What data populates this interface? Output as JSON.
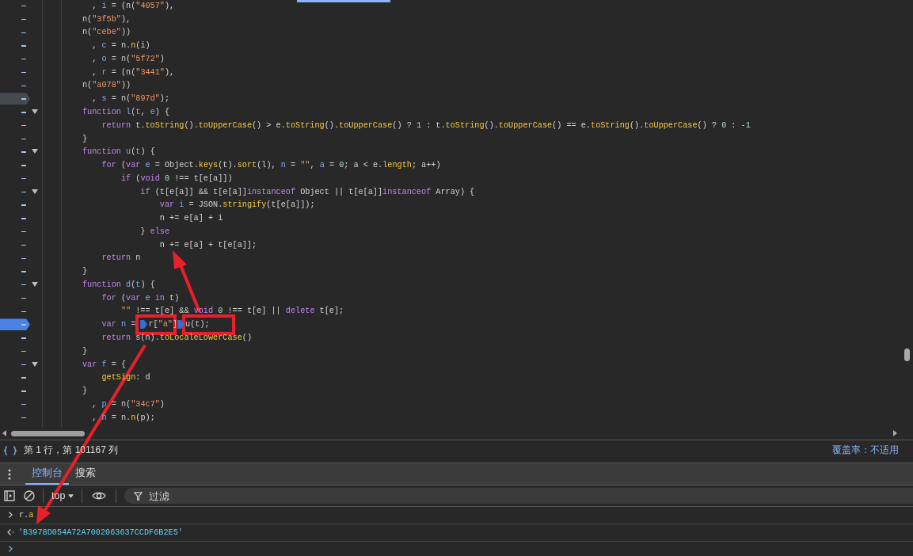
{
  "editor": {
    "lines": [
      {
        "foldable": false,
        "tokens": [
          {
            "text": "  , ",
            "kind": "plain"
          },
          {
            "text": "i",
            "kind": "variable"
          },
          {
            "text": " = (n(",
            "kind": "plain"
          },
          {
            "text": "\"4057\"",
            "kind": "string"
          },
          {
            "text": "),",
            "kind": "plain"
          }
        ]
      },
      {
        "foldable": false,
        "tokens": [
          {
            "text": "n(",
            "kind": "plain"
          },
          {
            "text": "\"3f5b\"",
            "kind": "string"
          },
          {
            "text": "),",
            "kind": "plain"
          }
        ]
      },
      {
        "foldable": false,
        "tokens": [
          {
            "text": "n(",
            "kind": "plain"
          },
          {
            "text": "\"cebe\"",
            "kind": "string"
          },
          {
            "text": "))",
            "kind": "plain"
          }
        ]
      },
      {
        "foldable": false,
        "tokens": [
          {
            "text": "  , ",
            "kind": "plain"
          },
          {
            "text": "c",
            "kind": "variable"
          },
          {
            "text": " = n.",
            "kind": "plain"
          },
          {
            "text": "n",
            "kind": "function"
          },
          {
            "text": "(i)",
            "kind": "plain"
          }
        ]
      },
      {
        "foldable": false,
        "tokens": [
          {
            "text": "  , ",
            "kind": "plain"
          },
          {
            "text": "o",
            "kind": "variable"
          },
          {
            "text": " = n(",
            "kind": "plain"
          },
          {
            "text": "\"5f72\"",
            "kind": "string"
          },
          {
            "text": ")",
            "kind": "plain"
          }
        ]
      },
      {
        "foldable": false,
        "tokens": [
          {
            "text": "  , ",
            "kind": "plain"
          },
          {
            "text": "r",
            "kind": "variable"
          },
          {
            "text": " = (n(",
            "kind": "plain"
          },
          {
            "text": "\"3441\"",
            "kind": "string"
          },
          {
            "text": "),",
            "kind": "plain"
          }
        ]
      },
      {
        "foldable": false,
        "tokens": [
          {
            "text": "n(",
            "kind": "plain"
          },
          {
            "text": "\"a078\"",
            "kind": "string"
          },
          {
            "text": "))",
            "kind": "plain"
          }
        ]
      },
      {
        "foldable": false,
        "breakpoint": {
          "enabled": false
        },
        "tokens": [
          {
            "text": "  , ",
            "kind": "plain"
          },
          {
            "text": "s",
            "kind": "variable"
          },
          {
            "text": " = n(",
            "kind": "plain"
          },
          {
            "text": "\"897d\"",
            "kind": "string"
          },
          {
            "text": ");",
            "kind": "plain"
          }
        ]
      },
      {
        "foldable": true,
        "tokens": [
          {
            "text": "function ",
            "kind": "keyword"
          },
          {
            "text": "l",
            "kind": "variable"
          },
          {
            "text": "(",
            "kind": "plain"
          },
          {
            "text": "t",
            "kind": "variable"
          },
          {
            "text": ", ",
            "kind": "plain"
          },
          {
            "text": "e",
            "kind": "variable"
          },
          {
            "text": ") {",
            "kind": "plain"
          }
        ]
      },
      {
        "foldable": false,
        "tokens": [
          {
            "text": "    return",
            "kind": "keyword"
          },
          {
            "text": " t.",
            "kind": "plain"
          },
          {
            "text": "toString",
            "kind": "function"
          },
          {
            "text": "().",
            "kind": "plain"
          },
          {
            "text": "toUpperCase",
            "kind": "function"
          },
          {
            "text": "() > e.",
            "kind": "plain"
          },
          {
            "text": "toString",
            "kind": "function"
          },
          {
            "text": "().",
            "kind": "plain"
          },
          {
            "text": "toUpperCase",
            "kind": "function"
          },
          {
            "text": "() ? ",
            "kind": "plain"
          },
          {
            "text": "1",
            "kind": "number"
          },
          {
            "text": " : t.",
            "kind": "plain"
          },
          {
            "text": "toString",
            "kind": "function"
          },
          {
            "text": "().",
            "kind": "plain"
          },
          {
            "text": "toUpperCase",
            "kind": "function"
          },
          {
            "text": "() == e.",
            "kind": "plain"
          },
          {
            "text": "toString",
            "kind": "function"
          },
          {
            "text": "().",
            "kind": "plain"
          },
          {
            "text": "toUpperCase",
            "kind": "function"
          },
          {
            "text": "() ? ",
            "kind": "plain"
          },
          {
            "text": "0",
            "kind": "number"
          },
          {
            "text": " : ",
            "kind": "plain"
          },
          {
            "text": "-1",
            "kind": "number"
          }
        ]
      },
      {
        "foldable": false,
        "tokens": [
          {
            "text": "}",
            "kind": "plain"
          }
        ]
      },
      {
        "foldable": true,
        "tokens": [
          {
            "text": "function ",
            "kind": "keyword"
          },
          {
            "text": "u",
            "kind": "variable"
          },
          {
            "text": "(",
            "kind": "plain"
          },
          {
            "text": "t",
            "kind": "variable"
          },
          {
            "text": ") {",
            "kind": "plain"
          }
        ]
      },
      {
        "foldable": false,
        "tokens": [
          {
            "text": "    for",
            "kind": "keyword"
          },
          {
            "text": " (",
            "kind": "plain"
          },
          {
            "text": "var ",
            "kind": "keyword"
          },
          {
            "text": "e",
            "kind": "variable"
          },
          {
            "text": " = Object.",
            "kind": "plain"
          },
          {
            "text": "keys",
            "kind": "function"
          },
          {
            "text": "(t).",
            "kind": "plain"
          },
          {
            "text": "sort",
            "kind": "function"
          },
          {
            "text": "(l), ",
            "kind": "plain"
          },
          {
            "text": "n",
            "kind": "variable"
          },
          {
            "text": " = ",
            "kind": "plain"
          },
          {
            "text": "\"\"",
            "kind": "string"
          },
          {
            "text": ", ",
            "kind": "plain"
          },
          {
            "text": "a",
            "kind": "variable"
          },
          {
            "text": " = ",
            "kind": "plain"
          },
          {
            "text": "0",
            "kind": "number"
          },
          {
            "text": "; a < e.",
            "kind": "plain"
          },
          {
            "text": "length",
            "kind": "function"
          },
          {
            "text": "; a++)",
            "kind": "plain"
          }
        ]
      },
      {
        "foldable": false,
        "tokens": [
          {
            "text": "        if",
            "kind": "keyword"
          },
          {
            "text": " (",
            "kind": "plain"
          },
          {
            "text": "void ",
            "kind": "keyword"
          },
          {
            "text": "0",
            "kind": "number"
          },
          {
            "text": " !== t[e[a]])",
            "kind": "plain"
          }
        ]
      },
      {
        "foldable": true,
        "tokens": [
          {
            "text": "            if",
            "kind": "keyword"
          },
          {
            "text": " (t[e[a]] && t[e[a]]",
            "kind": "plain"
          },
          {
            "text": "instanceof",
            "kind": "keyword"
          },
          {
            "text": " Object || t[e[a]]",
            "kind": "plain"
          },
          {
            "text": "instanceof",
            "kind": "keyword"
          },
          {
            "text": " Array) {",
            "kind": "plain"
          }
        ]
      },
      {
        "foldable": false,
        "tokens": [
          {
            "text": "                var ",
            "kind": "keyword"
          },
          {
            "text": "i",
            "kind": "variable"
          },
          {
            "text": " = JSON.",
            "kind": "plain"
          },
          {
            "text": "stringify",
            "kind": "function"
          },
          {
            "text": "(t[e[a]]);",
            "kind": "plain"
          }
        ]
      },
      {
        "foldable": false,
        "tokens": [
          {
            "text": "                n += e[a] + i",
            "kind": "plain"
          }
        ]
      },
      {
        "foldable": false,
        "tokens": [
          {
            "text": "            } ",
            "kind": "plain"
          },
          {
            "text": "else",
            "kind": "keyword"
          }
        ]
      },
      {
        "foldable": false,
        "tokens": [
          {
            "text": "                n += e[a] + t[e[a]];",
            "kind": "plain"
          }
        ]
      },
      {
        "foldable": false,
        "tokens": [
          {
            "text": "    return",
            "kind": "keyword"
          },
          {
            "text": " n",
            "kind": "plain"
          }
        ]
      },
      {
        "foldable": false,
        "tokens": [
          {
            "text": "}",
            "kind": "plain"
          }
        ]
      },
      {
        "foldable": true,
        "tokens": [
          {
            "text": "function ",
            "kind": "keyword"
          },
          {
            "text": "d",
            "kind": "variable"
          },
          {
            "text": "(",
            "kind": "plain"
          },
          {
            "text": "t",
            "kind": "variable"
          },
          {
            "text": ") {",
            "kind": "plain"
          }
        ]
      },
      {
        "foldable": false,
        "tokens": [
          {
            "text": "    for",
            "kind": "keyword"
          },
          {
            "text": " (",
            "kind": "plain"
          },
          {
            "text": "var ",
            "kind": "keyword"
          },
          {
            "text": "e",
            "kind": "variable"
          },
          {
            "text": " in",
            "kind": "keyword"
          },
          {
            "text": " t)",
            "kind": "plain"
          }
        ]
      },
      {
        "foldable": false,
        "tokens": [
          {
            "text": "        \"\"",
            "kind": "string"
          },
          {
            "text": " !== t[e] && ",
            "kind": "plain"
          },
          {
            "text": "void ",
            "kind": "keyword"
          },
          {
            "text": "0",
            "kind": "number"
          },
          {
            "text": " !== t[e] || ",
            "kind": "plain"
          },
          {
            "text": "delete",
            "kind": "keyword"
          },
          {
            "text": " t[e];",
            "kind": "plain"
          }
        ]
      },
      {
        "foldable": false,
        "breakpoint": {
          "enabled": true
        },
        "tokens": [
          {
            "text": "    var ",
            "kind": "keyword"
          },
          {
            "text": "n",
            "kind": "variable"
          },
          {
            "text": " = ",
            "kind": "plain"
          },
          {
            "kind": "breakpoint"
          },
          {
            "text": "r[",
            "kind": "plain"
          },
          {
            "text": "\"a\"",
            "kind": "string"
          },
          {
            "text": "]",
            "kind": "plain"
          },
          {
            "kind": "breakpoint"
          },
          {
            "text": "u(t);",
            "kind": "plain"
          }
        ]
      },
      {
        "foldable": false,
        "tokens": [
          {
            "text": "    return",
            "kind": "keyword"
          },
          {
            "text": " s(n).",
            "kind": "plain"
          },
          {
            "text": "toLocaleLowerCase",
            "kind": "function"
          },
          {
            "text": "()",
            "kind": "plain"
          }
        ]
      },
      {
        "foldable": false,
        "tokens": [
          {
            "text": "}",
            "kind": "plain"
          }
        ]
      },
      {
        "foldable": true,
        "tokens": [
          {
            "text": "var ",
            "kind": "keyword"
          },
          {
            "text": "f",
            "kind": "variable"
          },
          {
            "text": " = {",
            "kind": "plain"
          }
        ]
      },
      {
        "foldable": false,
        "tokens": [
          {
            "text": "    getSign",
            "kind": "function"
          },
          {
            "text": ": d",
            "kind": "plain"
          }
        ]
      },
      {
        "foldable": false,
        "tokens": [
          {
            "text": "}",
            "kind": "plain"
          }
        ]
      },
      {
        "foldable": false,
        "tokens": [
          {
            "text": "  , ",
            "kind": "plain"
          },
          {
            "text": "p",
            "kind": "variable"
          },
          {
            "text": " = n(",
            "kind": "plain"
          },
          {
            "text": "\"34c7\"",
            "kind": "string"
          },
          {
            "text": ")",
            "kind": "plain"
          }
        ]
      },
      {
        "foldable": false,
        "tokens": [
          {
            "text": "  , ",
            "kind": "plain"
          },
          {
            "text": "h",
            "kind": "variable"
          },
          {
            "text": " = n.",
            "kind": "plain"
          },
          {
            "text": "n",
            "kind": "function"
          },
          {
            "text": "(p);",
            "kind": "plain"
          }
        ]
      }
    ]
  },
  "status_bar": {
    "position": "第 1 行，第 101167 列",
    "coverage": "覆盖率：不适用"
  },
  "drawer": {
    "tabs": [
      {
        "label": "控制台",
        "selected": true
      },
      {
        "label": "搜索",
        "selected": false
      }
    ],
    "context": "top",
    "filter": {
      "placeholder": "过滤"
    },
    "console": [
      {
        "kind": "input",
        "tokens": [
          {
            "text": "r.",
            "kind": "plain"
          },
          {
            "text": "a",
            "kind": "function"
          }
        ]
      },
      {
        "kind": "output",
        "text": "'B3978D054A72A7002063637CCDF6B2E5'"
      },
      {
        "kind": "prompt"
      }
    ]
  }
}
